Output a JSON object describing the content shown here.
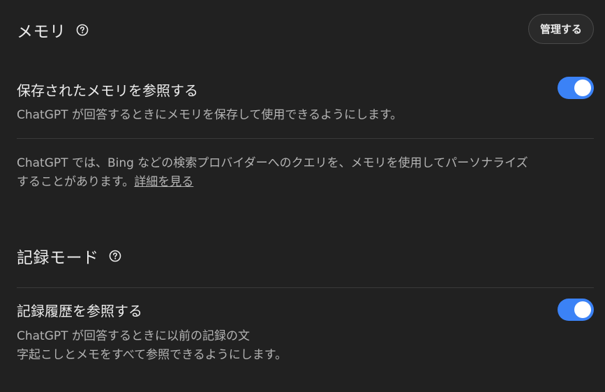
{
  "memory": {
    "title": "メモリ",
    "manage_button": "管理する",
    "saved_memory": {
      "title": "保存されたメモリを参照する",
      "description": "ChatGPT が回答するときにメモリを保存して使用できるようにします。",
      "enabled": true
    },
    "search_note": {
      "text_line1": "ChatGPT では、Bing などの検索プロバイダーへのクエリを、メモリを使用してパーソナライズ",
      "text_line2": "することがあります。",
      "link": "詳細を見る"
    }
  },
  "record_mode": {
    "title": "記録モード",
    "history": {
      "title": "記録履歴を参照する",
      "description_line1": "ChatGPT が回答するときに以前の記録の文",
      "description_line2": "字起こしとメモをすべて参照できるようにします。",
      "enabled": true
    }
  },
  "colors": {
    "background": "#212121",
    "toggle_on": "#3b82f6",
    "text_primary": "#ececec",
    "text_secondary": "#b4b4b4"
  },
  "icons": {
    "help": "question-circle-icon"
  }
}
